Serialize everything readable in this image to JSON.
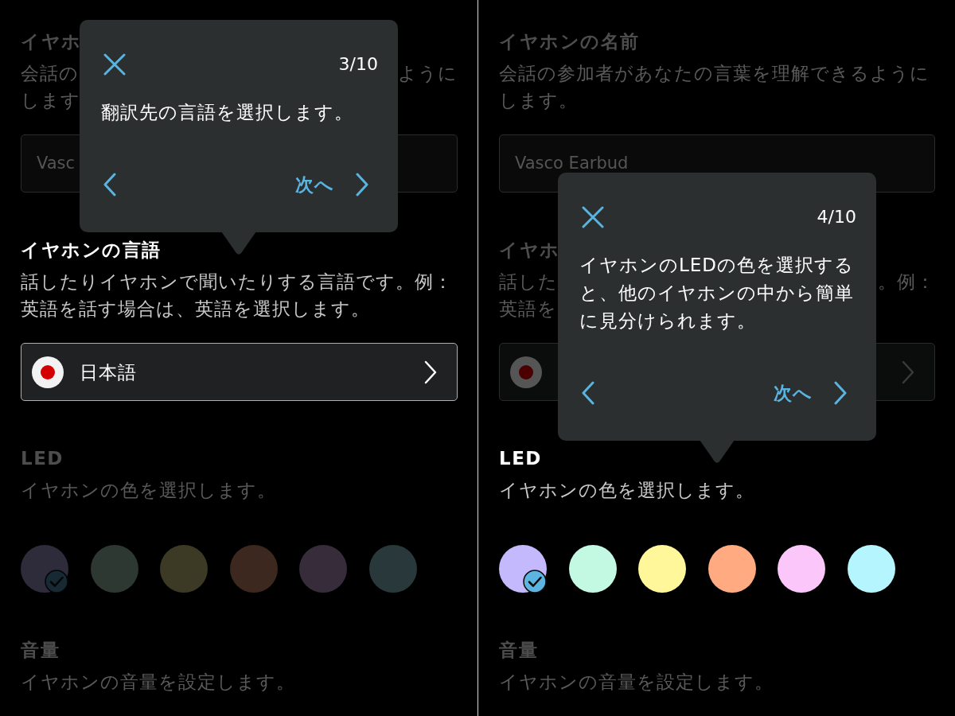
{
  "screens": [
    {
      "sections": [
        {
          "title": "イヤホ",
          "highlighted": false,
          "description_fragments": [
            [
              "会話の",
              "ように"
            ],
            [
              "します"
            ]
          ],
          "control": {
            "kind": "text_field",
            "value": "Vasc"
          }
        },
        {
          "title": "イヤホンの言語",
          "highlighted": true,
          "tour_tip": {
            "step": "3/10",
            "message": "翻訳先の言語を選択します。",
            "next_label": "次へ"
          },
          "description": "話したりイヤホンで聞いたりする言語です。例：英語を話す場合は、英語を選択します。",
          "control": {
            "kind": "select",
            "value": "日本語"
          }
        },
        {
          "title": "LED",
          "highlighted": false,
          "description": "イヤホンの色を選択します。",
          "control": {
            "kind": "color_picker",
            "swatches": [
              {
                "color": "#2e2b3b",
                "selected": true
              },
              {
                "color": "#2e3833",
                "selected": false
              },
              {
                "color": "#3c3a24",
                "selected": false
              },
              {
                "color": "#3c281e",
                "selected": false
              },
              {
                "color": "#372c39",
                "selected": false
              },
              {
                "color": "#29393b",
                "selected": false
              }
            ]
          }
        },
        {
          "title": "音量",
          "highlighted": false,
          "description": "イヤホンの音量を設定します。"
        }
      ]
    },
    {
      "sections": [
        {
          "title": "イヤホンの名前",
          "highlighted": false,
          "description": "会話の参加者があなたの言葉を理解できるようにします。",
          "control": {
            "kind": "text_field",
            "value": "Vasco Earbud"
          }
        },
        {
          "title": "イヤホ",
          "highlighted": false,
          "description_fragments": [
            [
              "話した",
              "。例："
            ],
            [
              "英語を"
            ]
          ],
          "control": {
            "kind": "select"
          }
        },
        {
          "title": "LED",
          "highlighted": true,
          "tour_tip": {
            "step": "4/10",
            "message": "イヤホンのLEDの色を選択すると、他のイヤホンの中から簡単に見分けられます。",
            "next_label": "次へ"
          },
          "description": "イヤホンの色を選択します。",
          "control": {
            "kind": "color_picker",
            "swatches": [
              {
                "color": "#c4b9fc",
                "selected": true
              },
              {
                "color": "#c3f8e3",
                "selected": false
              },
              {
                "color": "#fff799",
                "selected": false
              },
              {
                "color": "#ffaa80",
                "selected": false
              },
              {
                "color": "#fbc6f9",
                "selected": false
              },
              {
                "color": "#b5f6fe",
                "selected": false
              }
            ]
          }
        },
        {
          "title": "音量",
          "highlighted": false,
          "description": "イヤホンの音量を設定します。"
        }
      ]
    }
  ]
}
